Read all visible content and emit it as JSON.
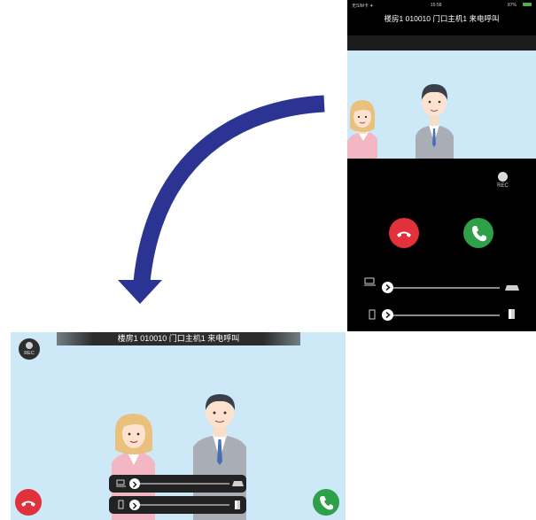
{
  "phone": {
    "status_carrier": "无SIM卡 ✦",
    "status_time": "16:58",
    "status_battery": "87%",
    "call_title": "楼房1 010010 门口主机1 来电呼叫",
    "rec_label": "REC"
  },
  "landscape": {
    "call_title": "楼房1 010010 门口主机1 来电呼叫",
    "rec_label": "REC"
  },
  "sliders": {
    "volume_level": 0.0,
    "brightness_level": 0.0
  },
  "colors": {
    "hangup": "#e0313c",
    "answer": "#2ea048",
    "arrow": "#2b3493",
    "video_bg": "#cde9f7"
  },
  "icons": {
    "arrow": "curved-arrow-icon",
    "hangup": "phone-hangup-icon",
    "answer": "phone-answer-icon",
    "volume": "monitor-icon",
    "brightness": "door-icon"
  }
}
